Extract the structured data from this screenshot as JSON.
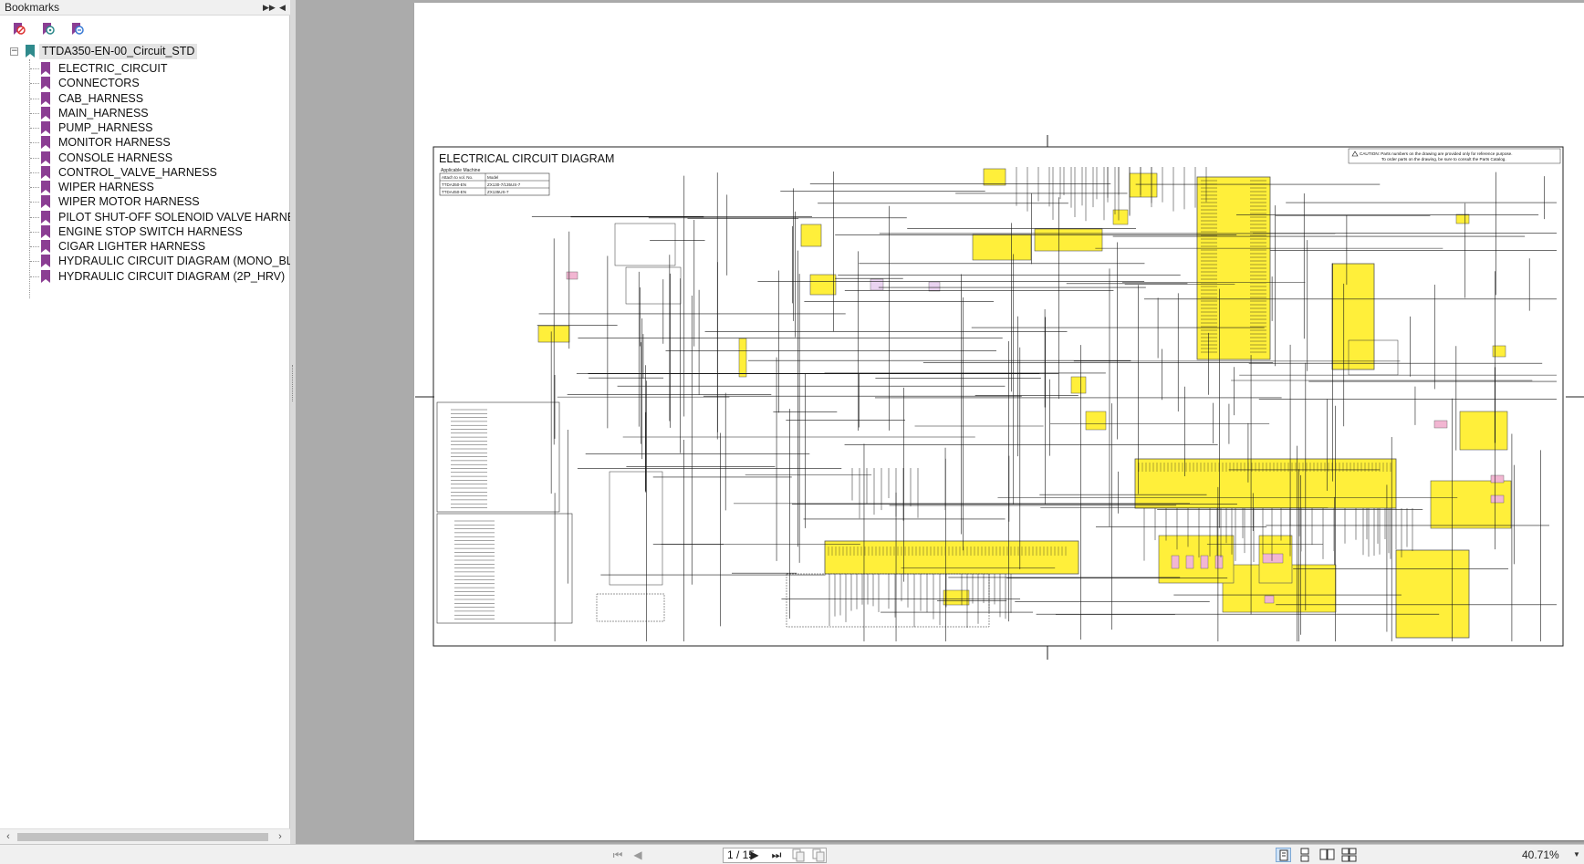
{
  "bookmarks": {
    "header_title": "Bookmarks",
    "root": {
      "label": "TTDA350-EN-00_Circuit_STD",
      "expanded_symbol": "−"
    },
    "items": [
      {
        "label": "ELECTRIC_CIRCUIT"
      },
      {
        "label": "CONNECTORS"
      },
      {
        "label": "CAB_HARNESS"
      },
      {
        "label": "MAIN_HARNESS"
      },
      {
        "label": "PUMP_HARNESS"
      },
      {
        "label": "MONITOR HARNESS"
      },
      {
        "label": "CONSOLE HARNESS"
      },
      {
        "label": "CONTROL_VALVE_HARNESS"
      },
      {
        "label": "WIPER HARNESS"
      },
      {
        "label": "WIPER MOTOR HARNESS"
      },
      {
        "label": "PILOT SHUT-OFF SOLENOID VALVE HARNESS"
      },
      {
        "label": "ENGINE STOP SWITCH HARNESS"
      },
      {
        "label": "CIGAR LIGHTER HARNESS"
      },
      {
        "label": "HYDRAULIC CIRCUIT DIAGRAM (MONO_BLADE"
      },
      {
        "label": "HYDRAULIC CIRCUIT DIAGRAM (2P_HRV)"
      }
    ]
  },
  "document": {
    "diagram_title": "ELECTRICAL CIRCUIT DIAGRAM",
    "applicable_table": {
      "caption": "Applicable Machine",
      "header": [
        "Attach to vol. No.",
        "Model"
      ],
      "rows": [
        [
          "TTDA350-EN",
          "ZX130-7/135US-7"
        ],
        [
          "TTDA450-EN",
          "ZX135US-7"
        ]
      ]
    },
    "caution": {
      "line1": "CAUTION: Parts numbers on the drawing are provided only for reference purpose.",
      "line2": "To order parts on the drawing, be sure to consult the Parts Catalog."
    }
  },
  "status": {
    "page_indicator": "1 / 15",
    "zoom": "40.71%"
  },
  "colors": {
    "accent_yellow": "#ffef3a",
    "bookmark_purple": "#8b3e93",
    "root_icon_teal": "#2f8a8c",
    "highlight_pink": "#f2b6d2"
  },
  "icons": {
    "nav_first": "first-page-icon",
    "nav_prev": "previous-page-icon",
    "nav_next": "next-page-icon",
    "nav_last": "last-page-icon"
  }
}
